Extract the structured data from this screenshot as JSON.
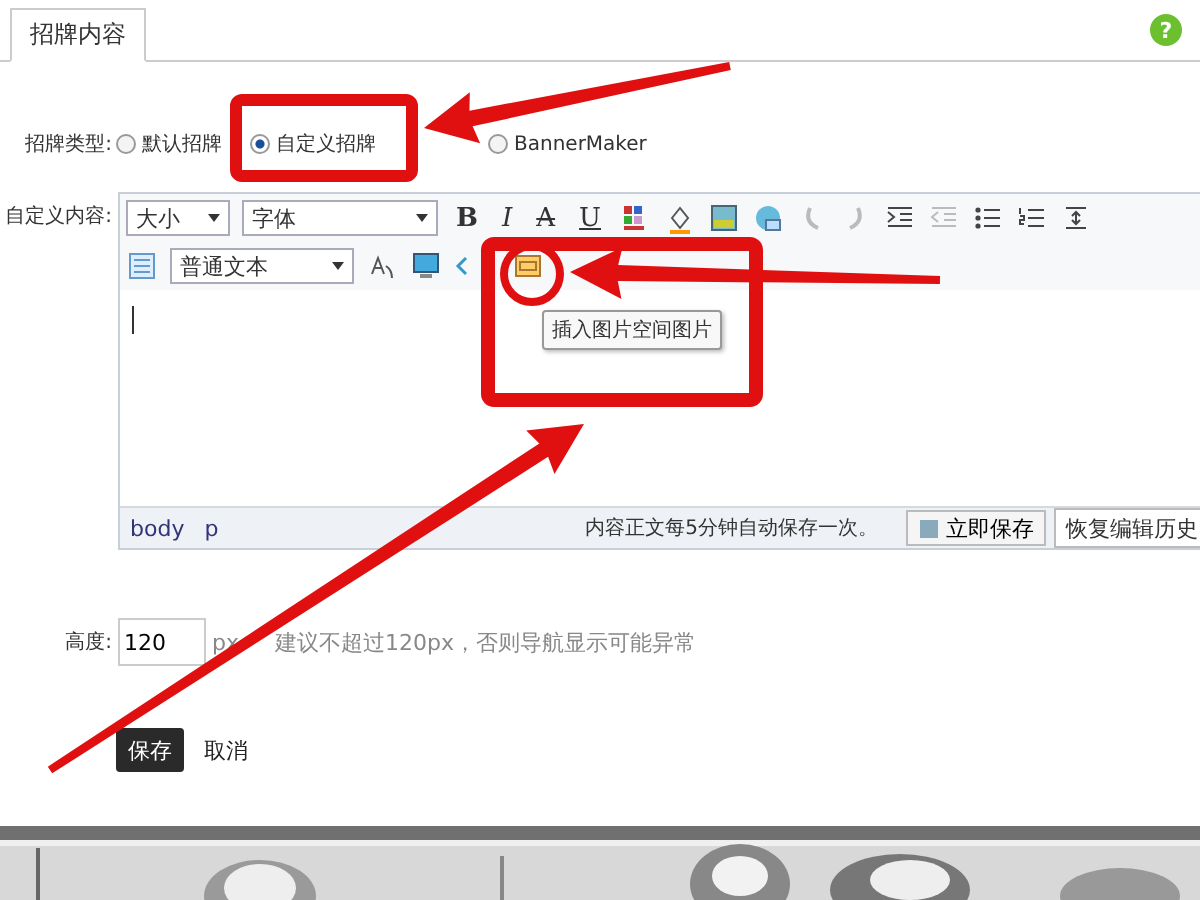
{
  "tabs": [
    {
      "label": "招牌内容",
      "selected": true
    }
  ],
  "help": {
    "icon": "?"
  },
  "sign_type": {
    "label": "招牌类型:",
    "options": [
      {
        "label": "默认招牌",
        "selected": false
      },
      {
        "label": "自定义招牌",
        "selected": true
      },
      {
        "label": "BannerMaker",
        "selected": false
      }
    ]
  },
  "custom_content": {
    "label": "自定义内容:",
    "toolbar_1": {
      "size_select": "大小",
      "font_select": "字体",
      "format_buttons": [
        "B",
        "I",
        "A",
        "U"
      ]
    },
    "toolbar_2": {
      "paragraph_select": "普通文本"
    },
    "tooltip": "插入图片空间图片",
    "status_bar": {
      "path": [
        "body",
        "p"
      ],
      "autosave_note": "内容正文每5分钟自动保存一次。",
      "save_now_button": "立即保存",
      "history_select": "恢复编辑历史"
    }
  },
  "height": {
    "label": "高度:",
    "value": "120",
    "unit": "px",
    "hint": "建议不超过120px，否则导航显示可能异常"
  },
  "buttons": [
    {
      "label": "保存",
      "kind": "primary"
    },
    {
      "label": "取消",
      "kind": "link"
    }
  ],
  "annotations": [
    {
      "kind": "box"
    },
    {
      "kind": "arrow"
    },
    {
      "kind": "box"
    },
    {
      "kind": "circle"
    },
    {
      "kind": "arrow"
    },
    {
      "kind": "arrow"
    }
  ]
}
